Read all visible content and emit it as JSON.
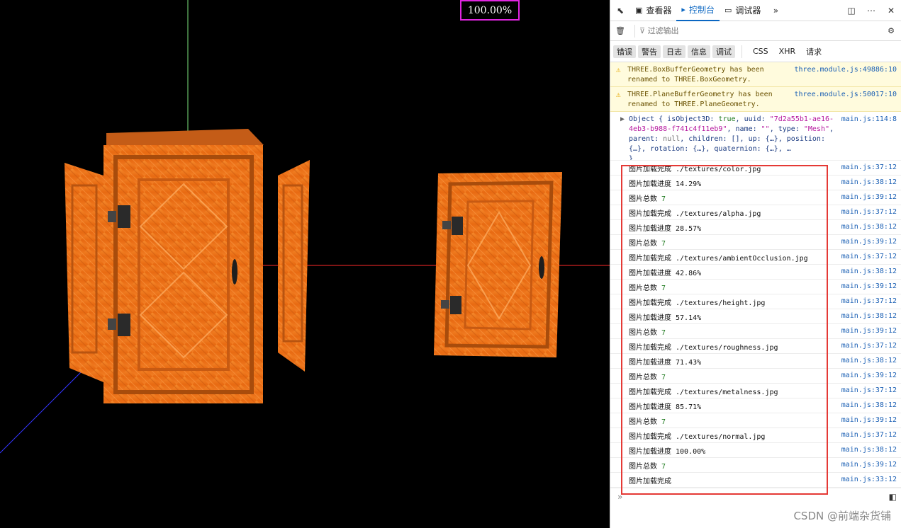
{
  "viewport": {
    "progress_text": "100.00%",
    "colors": {
      "door": "#f07a1e",
      "x_axis": "#ff2a2a",
      "y_axis": "#7de27d",
      "z_axis": "#3434ff",
      "progress_border": "#e026e0"
    }
  },
  "devtools": {
    "toolbar": {
      "inspect_icon": "cursor-icon",
      "tabs": [
        {
          "label": "查看器",
          "icon": "inspector-icon",
          "active": false
        },
        {
          "label": "控制台",
          "icon": "console-icon",
          "active": true
        },
        {
          "label": "调试器",
          "icon": "debugger-icon",
          "active": false
        }
      ],
      "more_tabs_icon": "double-chevron-icon",
      "dock_icon": "dock-icon",
      "menu_icon": "ellipsis-icon",
      "close_icon": "close-icon"
    },
    "filter": {
      "placeholder": "过滤输出",
      "trash_icon": "trash-icon",
      "settings_icon": "gear-icon"
    },
    "levels": [
      "错误",
      "警告",
      "日志",
      "信息",
      "调试"
    ],
    "categories": [
      "CSS",
      "XHR",
      "请求"
    ],
    "warnings": [
      {
        "text": "THREE.BoxBufferGeometry has been renamed to THREE.BoxGeometry.",
        "source": "three.module.js:49886:10"
      },
      {
        "text": "THREE.PlaneBufferGeometry has been renamed to THREE.PlaneGeometry.",
        "source": "three.module.js:50017:10"
      }
    ],
    "object_log": {
      "prefix": "Object { isObject3D: ",
      "isObject3D": "true",
      "uuid_label": ", uuid: ",
      "uuid": "\"7d2a55b1-ae16-4eb3-b988-f741c4f11eb9\"",
      "name_label": ", name: ",
      "name": "\"\"",
      "type_label": ", type: ",
      "type": "\"Mesh\"",
      "rest1": ", parent: ",
      "parent": "null",
      "rest2": ", children: [], up: {…}, position: {…}, rotation: {…}, quaternion: {…}, …",
      "close": "}",
      "source": "main.js:114:8"
    },
    "logs": [
      {
        "text": "图片加载完成 ./textures/color.jpg",
        "source": "main.js:37:12"
      },
      {
        "text": "图片加载进度 14.29%",
        "source": "main.js:38:12"
      },
      {
        "text": "图片总数",
        "num": "7",
        "source": "main.js:39:12"
      },
      {
        "text": "图片加载完成 ./textures/alpha.jpg",
        "source": "main.js:37:12"
      },
      {
        "text": "图片加载进度 28.57%",
        "source": "main.js:38:12"
      },
      {
        "text": "图片总数",
        "num": "7",
        "source": "main.js:39:12"
      },
      {
        "text": "图片加载完成 ./textures/ambientOcclusion.jpg",
        "source": "main.js:37:12"
      },
      {
        "text": "图片加载进度 42.86%",
        "source": "main.js:38:12"
      },
      {
        "text": "图片总数",
        "num": "7",
        "source": "main.js:39:12"
      },
      {
        "text": "图片加载完成 ./textures/height.jpg",
        "source": "main.js:37:12"
      },
      {
        "text": "图片加载进度 57.14%",
        "source": "main.js:38:12"
      },
      {
        "text": "图片总数",
        "num": "7",
        "source": "main.js:39:12"
      },
      {
        "text": "图片加载完成 ./textures/roughness.jpg",
        "source": "main.js:37:12"
      },
      {
        "text": "图片加载进度 71.43%",
        "source": "main.js:38:12"
      },
      {
        "text": "图片总数",
        "num": "7",
        "source": "main.js:39:12"
      },
      {
        "text": "图片加载完成 ./textures/metalness.jpg",
        "source": "main.js:37:12"
      },
      {
        "text": "图片加载进度 85.71%",
        "source": "main.js:38:12"
      },
      {
        "text": "图片总数",
        "num": "7",
        "source": "main.js:39:12"
      },
      {
        "text": "图片加载完成 ./textures/normal.jpg",
        "source": "main.js:37:12"
      },
      {
        "text": "图片加载进度 100.00%",
        "source": "main.js:38:12"
      },
      {
        "text": "图片总数",
        "num": "7",
        "source": "main.js:39:12"
      },
      {
        "text": "图片加载完成",
        "source": "main.js:33:12"
      }
    ],
    "prompt_symbol": "»"
  },
  "watermark": "CSDN @前端杂货铺"
}
